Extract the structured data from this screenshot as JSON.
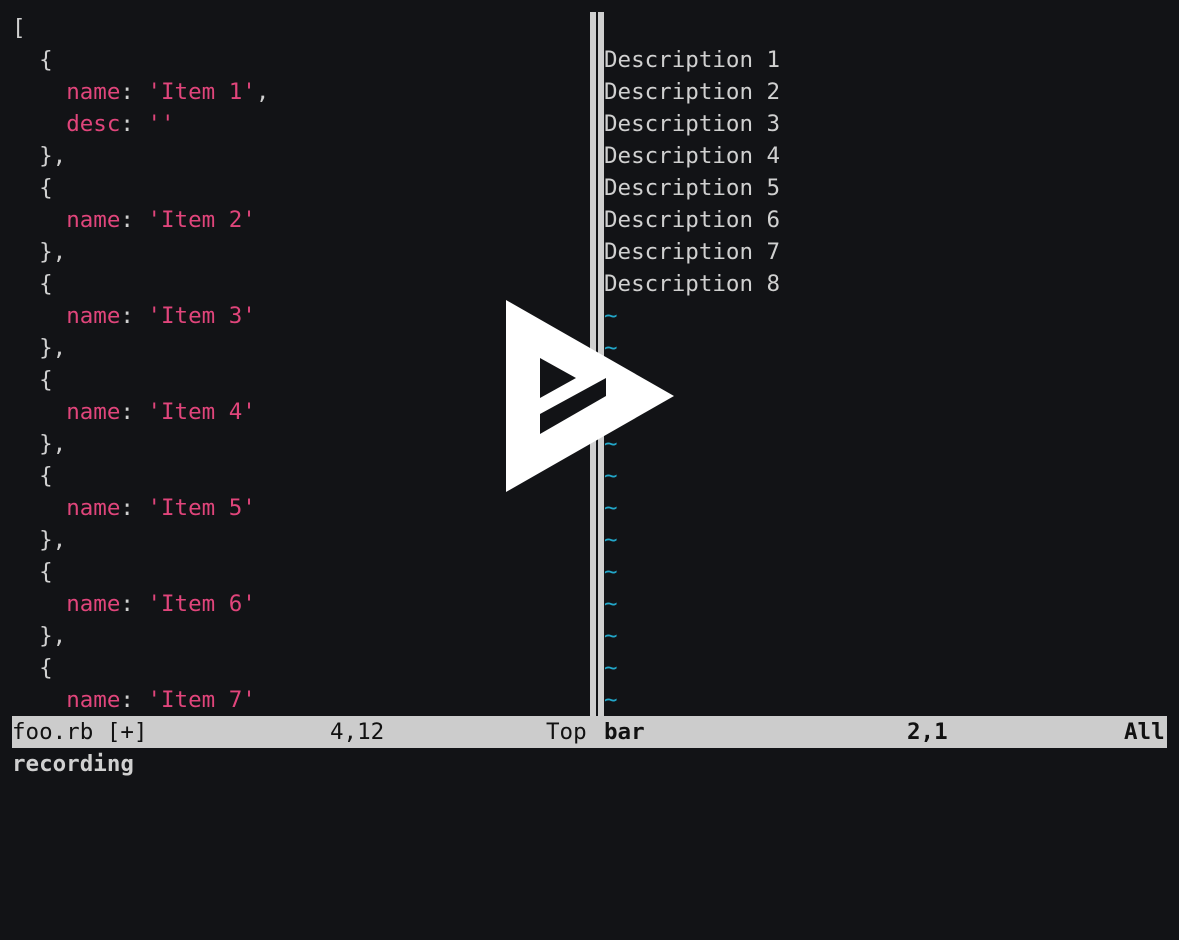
{
  "left_buffer": {
    "lines": [
      [
        {
          "t": "[",
          "c": "punct"
        }
      ],
      [
        {
          "t": "  {",
          "c": "punct"
        }
      ],
      [
        {
          "t": "    ",
          "c": "punct"
        },
        {
          "t": "name",
          "c": "key"
        },
        {
          "t": ": ",
          "c": "punct"
        },
        {
          "t": "'Item 1'",
          "c": "str"
        },
        {
          "t": ",",
          "c": "punct"
        }
      ],
      [
        {
          "t": "    ",
          "c": "punct"
        },
        {
          "t": "desc",
          "c": "key"
        },
        {
          "t": ": ",
          "c": "punct"
        },
        {
          "t": "''",
          "c": "str"
        }
      ],
      [
        {
          "t": "  },",
          "c": "punct"
        }
      ],
      [
        {
          "t": "  {",
          "c": "punct"
        }
      ],
      [
        {
          "t": "    ",
          "c": "punct"
        },
        {
          "t": "name",
          "c": "key"
        },
        {
          "t": ": ",
          "c": "punct"
        },
        {
          "t": "'Item 2'",
          "c": "str"
        }
      ],
      [
        {
          "t": "  },",
          "c": "punct"
        }
      ],
      [
        {
          "t": "  {",
          "c": "punct"
        }
      ],
      [
        {
          "t": "    ",
          "c": "punct"
        },
        {
          "t": "name",
          "c": "key"
        },
        {
          "t": ": ",
          "c": "punct"
        },
        {
          "t": "'Item 3'",
          "c": "str"
        }
      ],
      [
        {
          "t": "  },",
          "c": "punct"
        }
      ],
      [
        {
          "t": "  {",
          "c": "punct"
        }
      ],
      [
        {
          "t": "    ",
          "c": "punct"
        },
        {
          "t": "name",
          "c": "key"
        },
        {
          "t": ": ",
          "c": "punct"
        },
        {
          "t": "'Item 4'",
          "c": "str"
        }
      ],
      [
        {
          "t": "  },",
          "c": "punct"
        }
      ],
      [
        {
          "t": "  {",
          "c": "punct"
        }
      ],
      [
        {
          "t": "    ",
          "c": "punct"
        },
        {
          "t": "name",
          "c": "key"
        },
        {
          "t": ": ",
          "c": "punct"
        },
        {
          "t": "'Item 5'",
          "c": "str"
        }
      ],
      [
        {
          "t": "  },",
          "c": "punct"
        }
      ],
      [
        {
          "t": "  {",
          "c": "punct"
        }
      ],
      [
        {
          "t": "    ",
          "c": "punct"
        },
        {
          "t": "name",
          "c": "key"
        },
        {
          "t": ": ",
          "c": "punct"
        },
        {
          "t": "'Item 6'",
          "c": "str"
        }
      ],
      [
        {
          "t": "  },",
          "c": "punct"
        }
      ],
      [
        {
          "t": "  {",
          "c": "punct"
        }
      ],
      [
        {
          "t": "    ",
          "c": "punct"
        },
        {
          "t": "name",
          "c": "key"
        },
        {
          "t": ": ",
          "c": "punct"
        },
        {
          "t": "'Item 7'",
          "c": "str"
        }
      ]
    ]
  },
  "right_buffer": {
    "lines": [
      "",
      "Description 1",
      "Description 2",
      "Description 3",
      "Description 4",
      "Description 5",
      "Description 6",
      "Description 7",
      "Description 8"
    ],
    "empty_marker": "~",
    "empty_line_count": 13
  },
  "statusline": {
    "left_file": "foo.rb [+]",
    "left_pos": "4,12",
    "left_scroll": "Top",
    "right_file": "bar",
    "right_pos": "2,1",
    "right_scroll": "All"
  },
  "cmdline": {
    "text": "recording"
  },
  "colors": {
    "background": "#121316",
    "keyword": "#e0457b",
    "tilde": "#22a7c9",
    "statusbar": "#cccccc"
  },
  "overlay": {
    "icon": "play-icon"
  }
}
